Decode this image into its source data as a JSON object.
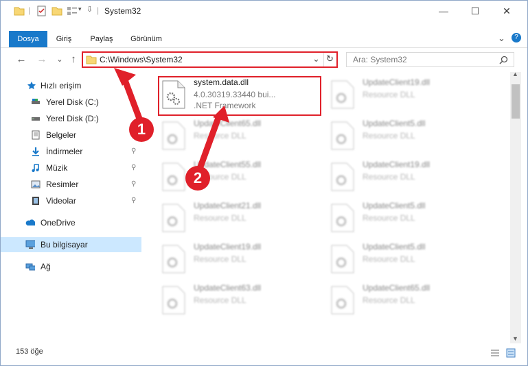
{
  "window": {
    "title": "System32",
    "minimize": "—",
    "maximize": "☐",
    "close": "✕"
  },
  "ribbon": {
    "tabs": [
      {
        "label": "Dosya",
        "active": true
      },
      {
        "label": "Giriş"
      },
      {
        "label": "Paylaş"
      },
      {
        "label": "Görünüm"
      }
    ],
    "expand": "⌄",
    "help": "?"
  },
  "address": {
    "path": "C:\\Windows\\System32",
    "dropdown": "⌄",
    "refresh": "↻"
  },
  "search": {
    "placeholder": "Ara: System32",
    "icon": "search-icon"
  },
  "nav": {
    "back": "←",
    "forward": "→",
    "recent": "⌄",
    "up": "↑"
  },
  "sidebar": {
    "items": [
      {
        "label": "Hızlı erişim",
        "icon": "star-icon",
        "pinned": false
      },
      {
        "label": "Yerel Disk (C:)",
        "icon": "drive-icon",
        "pinned": true
      },
      {
        "label": "Yerel Disk (D:)",
        "icon": "drive-icon",
        "pinned": true
      },
      {
        "label": "Belgeler",
        "icon": "documents-icon",
        "pinned": true
      },
      {
        "label": "İndirmeler",
        "icon": "download-icon",
        "pinned": true
      },
      {
        "label": "Müzik",
        "icon": "music-icon",
        "pinned": true
      },
      {
        "label": "Resimler",
        "icon": "pictures-icon",
        "pinned": true
      },
      {
        "label": "Videolar",
        "icon": "video-icon",
        "pinned": true
      },
      {
        "label": "OneDrive",
        "icon": "cloud-icon",
        "pinned": false
      },
      {
        "label": "Bu bilgisayar",
        "icon": "computer-icon",
        "pinned": false,
        "selected": true
      },
      {
        "label": "Ağ",
        "icon": "network-icon",
        "pinned": false
      }
    ],
    "pin_glyph": "📌"
  },
  "files": {
    "highlighted": {
      "name": "system.data.dll",
      "line2": "4.0.30319.33440 bui...",
      "line3": ".NET Framework"
    },
    "left_column": [
      {
        "name": "UpdateClient65.dll",
        "type": "Resource DLL"
      },
      {
        "name": "UpdateClient55.dll",
        "type": "Resource DLL"
      },
      {
        "name": "UpdateClient21.dll",
        "type": "Resource DLL"
      },
      {
        "name": "UpdateClient19.dll",
        "type": "Resource DLL"
      },
      {
        "name": "UpdateClient63.dll",
        "type": "Resource DLL"
      }
    ],
    "right_column": [
      {
        "name": "UpdateClient19.dll",
        "type": "Resource DLL"
      },
      {
        "name": "UpdateClient5.dll",
        "type": "Resource DLL"
      },
      {
        "name": "UpdateClient19.dll",
        "type": "Resource DLL"
      },
      {
        "name": "UpdateClient5.dll",
        "type": "Resource DLL"
      },
      {
        "name": "UpdateClient5.dll",
        "type": "Resource DLL"
      },
      {
        "name": "UpdateClient65.dll",
        "type": "Resource DLL"
      }
    ]
  },
  "callouts": {
    "one": "1",
    "two": "2"
  },
  "status": {
    "count": "153 öğe"
  },
  "colors": {
    "accent": "#1979ca",
    "highlight": "#e0202a",
    "selected": "#cce8ff"
  }
}
